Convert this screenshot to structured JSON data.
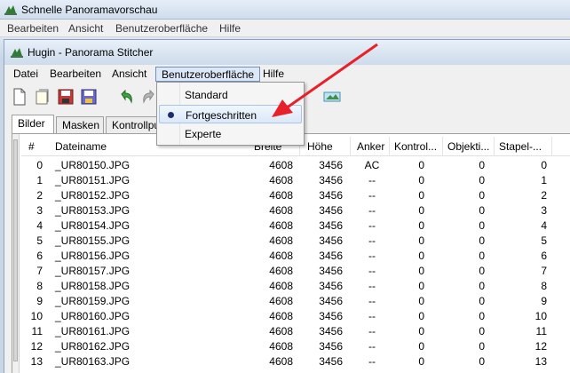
{
  "outer": {
    "title": "Schnelle Panoramavorschau",
    "menu": [
      "Bearbeiten",
      "Ansicht",
      "Benutzeroberfläche",
      "Hilfe"
    ]
  },
  "inner": {
    "title": "Hugin - Panorama Stitcher",
    "menu": [
      "Datei",
      "Bearbeiten",
      "Ansicht",
      "Benutzeroberfläche",
      "Hilfe"
    ]
  },
  "dropdown": {
    "items": [
      "Standard",
      "Fortgeschritten",
      "Experte"
    ],
    "selected": "Fortgeschritten"
  },
  "tabs": [
    "Bilder",
    "Masken",
    "Kontrollpu"
  ],
  "table": {
    "headers": [
      "#",
      "Dateiname",
      "Breite",
      "Höhe",
      "Anker",
      "Kontrol...",
      "Objekti...",
      "Stapel-..."
    ],
    "rows": [
      [
        "0",
        "_UR80150.JPG",
        "4608",
        "3456",
        "AC",
        "0",
        "0",
        "0"
      ],
      [
        "1",
        "_UR80151.JPG",
        "4608",
        "3456",
        "--",
        "0",
        "0",
        "1"
      ],
      [
        "2",
        "_UR80152.JPG",
        "4608",
        "3456",
        "--",
        "0",
        "0",
        "2"
      ],
      [
        "3",
        "_UR80153.JPG",
        "4608",
        "3456",
        "--",
        "0",
        "0",
        "3"
      ],
      [
        "4",
        "_UR80154.JPG",
        "4608",
        "3456",
        "--",
        "0",
        "0",
        "4"
      ],
      [
        "5",
        "_UR80155.JPG",
        "4608",
        "3456",
        "--",
        "0",
        "0",
        "5"
      ],
      [
        "6",
        "_UR80156.JPG",
        "4608",
        "3456",
        "--",
        "0",
        "0",
        "6"
      ],
      [
        "7",
        "_UR80157.JPG",
        "4608",
        "3456",
        "--",
        "0",
        "0",
        "7"
      ],
      [
        "8",
        "_UR80158.JPG",
        "4608",
        "3456",
        "--",
        "0",
        "0",
        "8"
      ],
      [
        "9",
        "_UR80159.JPG",
        "4608",
        "3456",
        "--",
        "0",
        "0",
        "9"
      ],
      [
        "10",
        "_UR80160.JPG",
        "4608",
        "3456",
        "--",
        "0",
        "0",
        "10"
      ],
      [
        "11",
        "_UR80161.JPG",
        "4608",
        "3456",
        "--",
        "0",
        "0",
        "11"
      ],
      [
        "12",
        "_UR80162.JPG",
        "4608",
        "3456",
        "--",
        "0",
        "0",
        "12"
      ],
      [
        "13",
        "_UR80163.JPG",
        "4608",
        "3456",
        "--",
        "0",
        "0",
        "13"
      ]
    ]
  },
  "colors": {
    "annotation_arrow": "#e8202a",
    "menu_highlight": "#dce8f7"
  },
  "icons": [
    "hugin-app-icon",
    "new-project-icon",
    "open-project-icon",
    "save-icon",
    "save-as-icon",
    "undo-icon",
    "redo-icon",
    "preview-icon"
  ]
}
